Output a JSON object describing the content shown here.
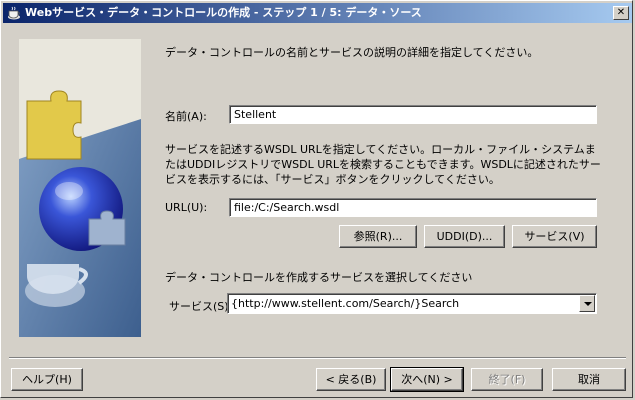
{
  "window": {
    "title": "Webサービス・データ・コントロールの作成 - ステップ 1 / 5: データ・ソース",
    "close_glyph": "✕",
    "app_icon": "coffee-cup-icon"
  },
  "main": {
    "description": "データ・コントロールの名前とサービスの説明の詳細を指定してください。",
    "name_label": "名前(A):",
    "name_value": "Stellent",
    "wsdl_help": "サービスを記述するWSDL URLを指定してください。ローカル・ファイル・システムまたはUDDIレジストリでWSDL URLを検索することもできます。WSDLに記述されたサービスを表示するには、「サービス」ボタンをクリックしてください。",
    "url_label": "URL(U):",
    "url_value": "file:/C:/Search.wsdl",
    "browse_button": "参照(R)...",
    "uddi_button": "UDDI(D)...",
    "service_button": "サービス(V)",
    "select_service_prompt": "データ・コントロールを作成するサービスを選択してください",
    "service_label": "サービス(S):",
    "service_value": "{http://www.stellent.com/Search/}Search"
  },
  "footer": {
    "help_button": "ヘルプ(H)",
    "back_button": "< 戻る(B)",
    "next_button": "次へ(N) >",
    "finish_button": "終了(F)",
    "cancel_button": "取消"
  },
  "colors": {
    "titlebar_start": "#0a246a",
    "titlebar_end": "#a6caf0",
    "dialog_face": "#d4d0c8"
  }
}
